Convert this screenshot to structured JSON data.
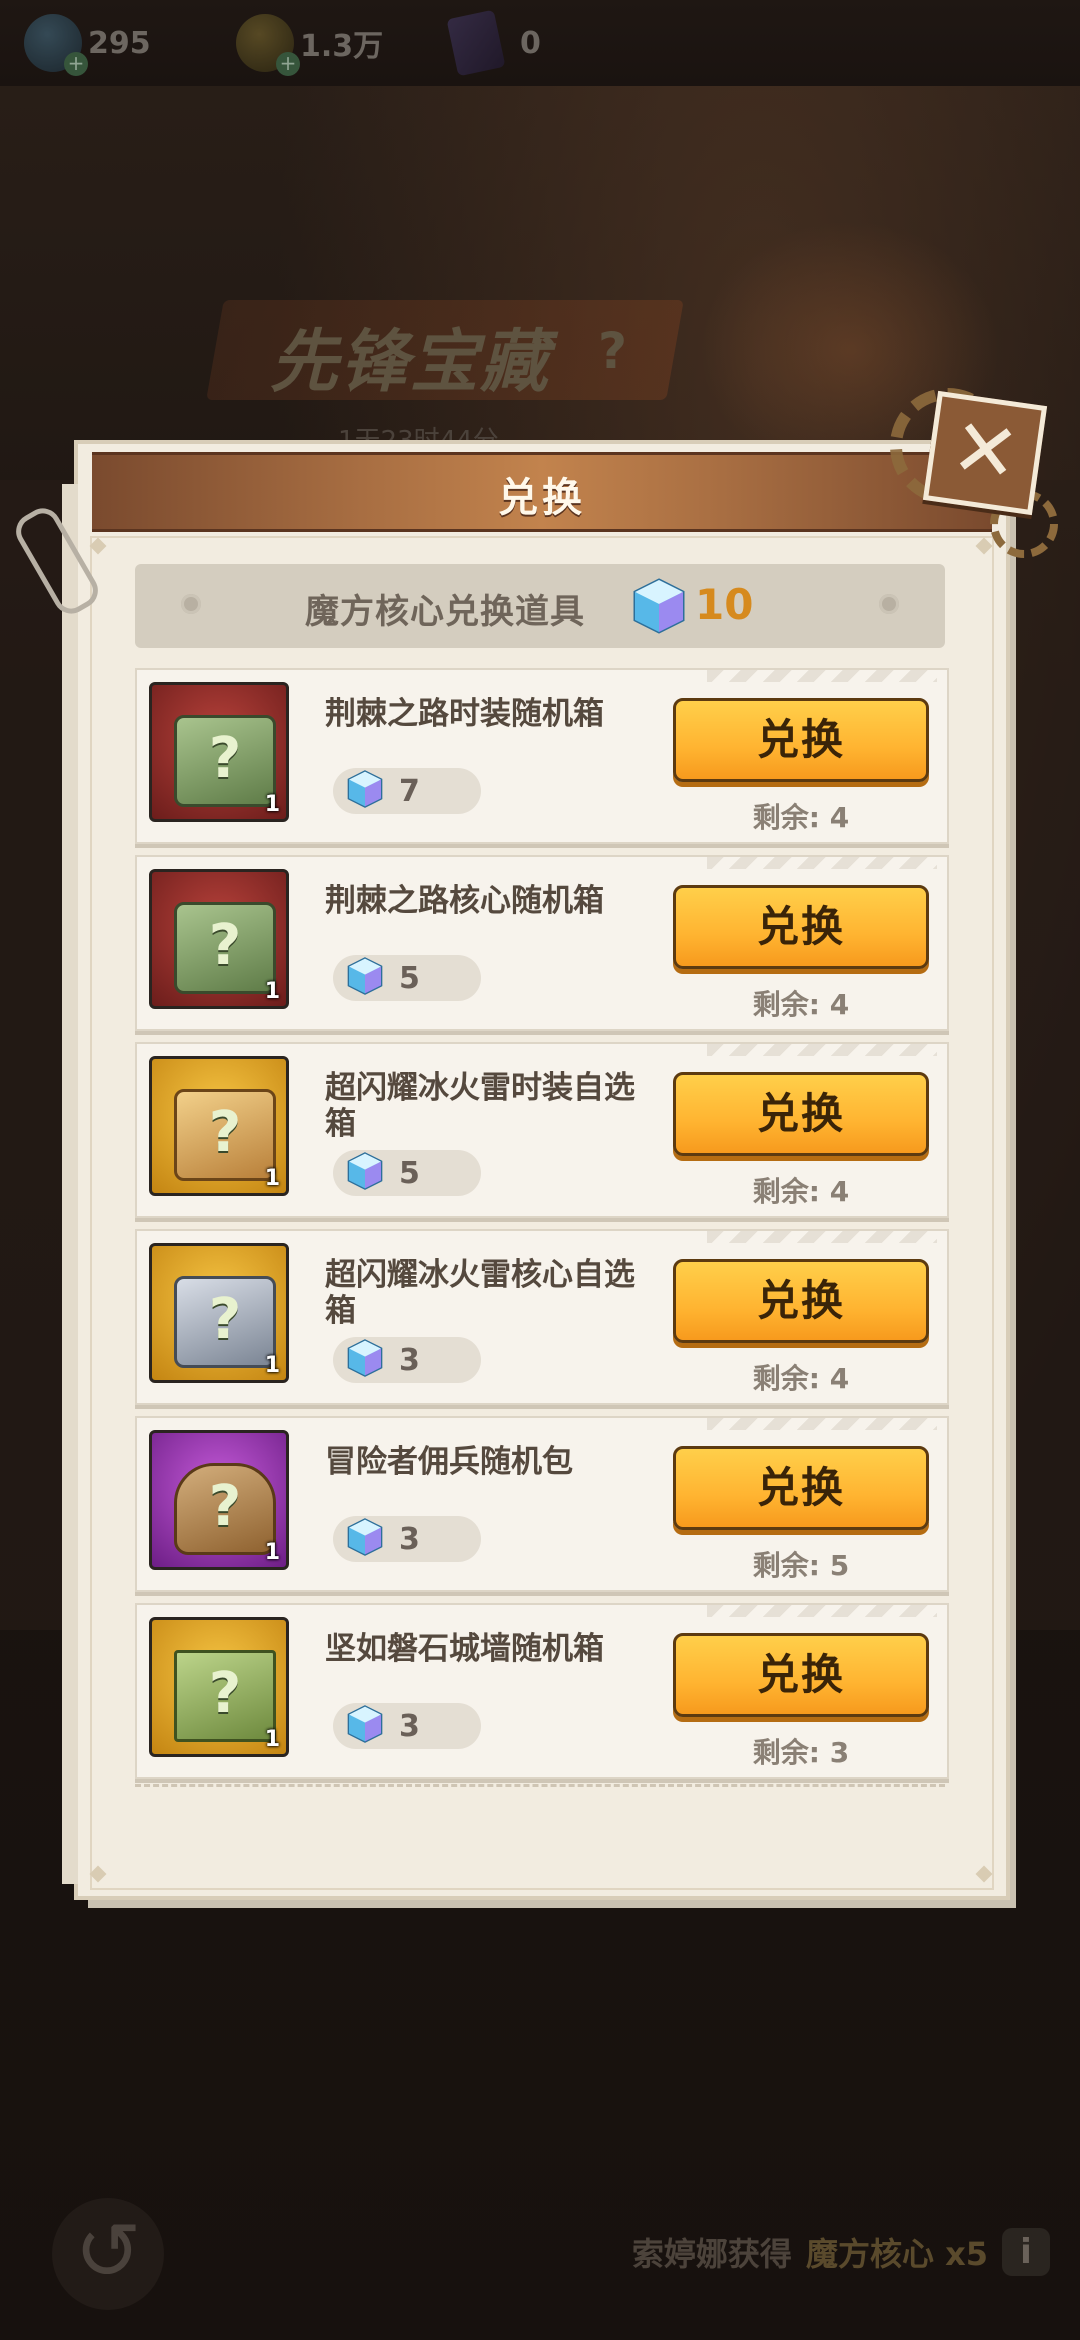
{
  "resources": [
    {
      "icon": "gem-icon",
      "value": "295"
    },
    {
      "icon": "p-coin-icon",
      "value": "1.3万"
    },
    {
      "icon": "card-icon",
      "value": "0"
    }
  ],
  "background": {
    "banner_title": "先锋宝藏",
    "banner_help": "?",
    "banner_sub": "1天23时44分",
    "bottom_info_name": "索婷娜获得",
    "bottom_info_item": "魔方核心 x5",
    "info_icon": "i",
    "back_icon": "↺"
  },
  "modal": {
    "title": "兑换",
    "close_icon": "✕",
    "currency_label": "魔方核心兑换道具",
    "currency_count": "10",
    "items": [
      {
        "name": "荆棘之路时装随机箱",
        "cost": "7",
        "qty": "1",
        "button": "兑换",
        "remain": "剩余: 4",
        "bg": "red",
        "box": "q"
      },
      {
        "name": "荆棘之路核心随机箱",
        "cost": "5",
        "qty": "1",
        "button": "兑换",
        "remain": "剩余: 4",
        "bg": "red",
        "box": "q"
      },
      {
        "name": "超闪耀冰火雷时装自选箱",
        "cost": "5",
        "qty": "1",
        "button": "兑换",
        "remain": "剩余: 4",
        "bg": "gold",
        "box": "gift"
      },
      {
        "name": "超闪耀冰火雷核心自选箱",
        "cost": "3",
        "qty": "1",
        "button": "兑换",
        "remain": "剩余: 4",
        "bg": "gold",
        "box": "steel"
      },
      {
        "name": "冒险者佣兵随机包",
        "cost": "3",
        "qty": "1",
        "button": "兑换",
        "remain": "剩余: 5",
        "bg": "purple",
        "box": "bag"
      },
      {
        "name": "坚如磐石城墙随机箱",
        "cost": "3",
        "qty": "1",
        "button": "兑换",
        "remain": "剩余: 3",
        "bg": "gold",
        "box": "stone"
      }
    ]
  },
  "colors": {
    "accent": "#ffb431",
    "header": "#a86e42",
    "panel": "#f2ece0",
    "currency_count": "#d68a1e"
  }
}
